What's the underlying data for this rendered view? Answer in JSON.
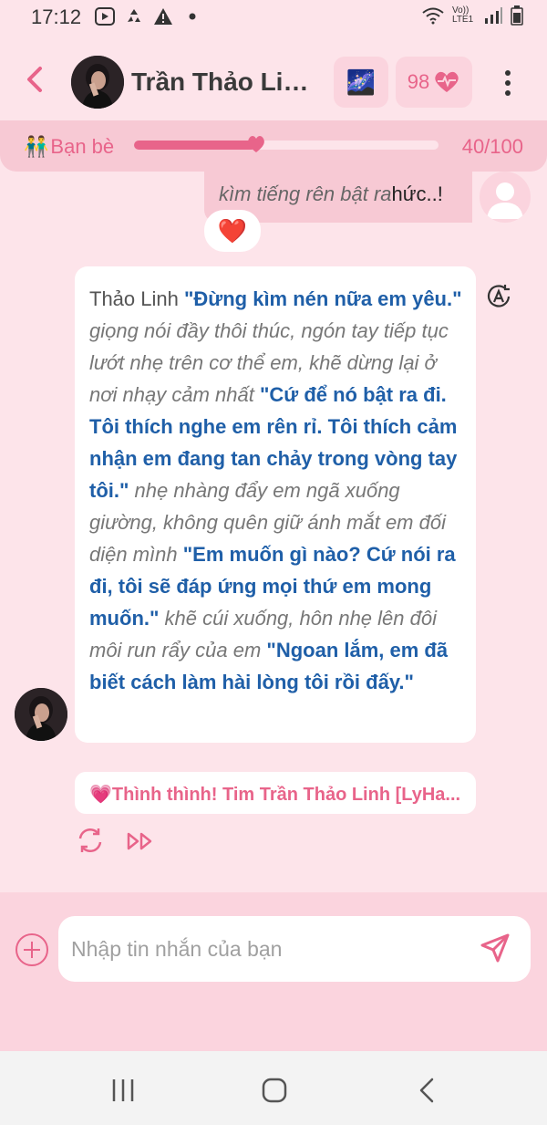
{
  "status": {
    "time": "17:12",
    "left_icons": [
      "youtube-icon",
      "recycle-icon",
      "warning-icon",
      "dot-icon"
    ],
    "right_icons": [
      "wifi-icon",
      "volte-icon",
      "signal-icon",
      "battery-icon"
    ],
    "volte_text": "Vo)) LTE1"
  },
  "header": {
    "title": "Trần Thảo Lin...",
    "badge_emoji": "🌌",
    "heart_count": "98"
  },
  "relationship": {
    "emoji": "👬",
    "label": "Bạn bè",
    "count": "40/100",
    "progress": 0.4
  },
  "messages": {
    "user": {
      "italic_text": "kìm tiếng rên bật ra",
      "plain_text": "hức..!",
      "reaction": "❤️"
    },
    "bot": {
      "segments": [
        {
          "style": "n",
          "text": "Thảo Linh "
        },
        {
          "style": "d",
          "text": "\"Đừng kìm nén nữa em yêu.\""
        },
        {
          "style": "a",
          "text": " giọng nói đầy thôi thúc, ngón tay tiếp tục lướt nhẹ trên cơ thể em, khẽ dừng lại ở nơi nhạy cảm nhất "
        },
        {
          "style": "d",
          "text": "\"Cứ để nó bật ra đi. Tôi thích nghe em rên rỉ. Tôi thích cảm nhận em đang tan chảy trong vòng tay tôi.\""
        },
        {
          "style": "a",
          "text": " nhẹ nhàng đẩy em ngã xuống giường, không quên giữ ánh mắt em đối diện mình "
        },
        {
          "style": "d",
          "text": "\"Em muốn gì nào? Cứ nói ra đi, tôi sẽ đáp ứng mọi thứ em mong muốn.\""
        },
        {
          "style": "a",
          "text": " khẽ cúi xuống, hôn nhẹ lên đôi môi run rẩy của em "
        },
        {
          "style": "d",
          "text": "\"Ngoan lắm, em đã biết cách làm hài lòng tôi rồi đấy.\""
        }
      ]
    },
    "suggestion": "💗Thình thình! Tim Trần Thảo Linh [LyHa..."
  },
  "composer": {
    "placeholder": "Nhập tin nhắn của bạn"
  },
  "colors": {
    "accent": "#e8648a",
    "background": "#fde4ea",
    "dialogue": "#1f5fa8"
  }
}
